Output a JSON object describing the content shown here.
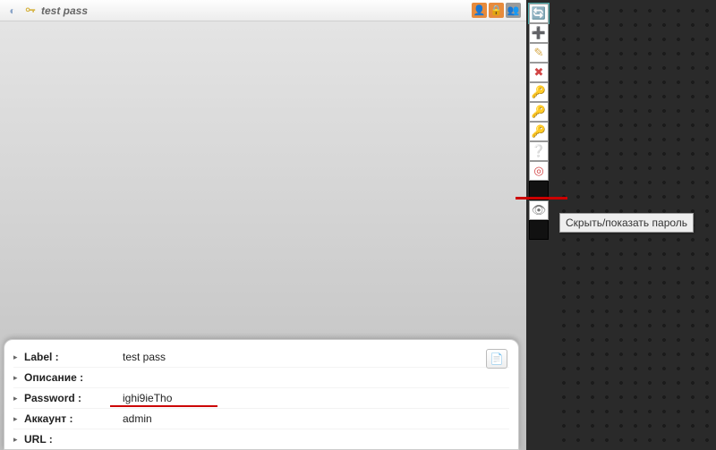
{
  "header": {
    "title": "test pass",
    "badges": [
      {
        "name": "person-badge",
        "glyph": "👤",
        "bg": "#e78b3c"
      },
      {
        "name": "lock-badge",
        "glyph": "🔒",
        "bg": "#e78b3c"
      },
      {
        "name": "people-badge",
        "glyph": "👥",
        "bg": "#9a9a9a"
      }
    ]
  },
  "details": {
    "rows": [
      {
        "label": "Label :",
        "value": "test pass"
      },
      {
        "label": "Описание :",
        "value": ""
      },
      {
        "label": "Password :",
        "value": "ighi9ieTho"
      },
      {
        "label": "Аккаунт :",
        "value": "admin"
      },
      {
        "label": "URL :",
        "value": ""
      }
    ]
  },
  "tooltip": "Скрыть/показать пароль",
  "sidebar": {
    "buttons": [
      {
        "name": "refresh",
        "glyph": "🔄",
        "color": "#2aa5d8"
      },
      {
        "name": "add",
        "glyph": "➕",
        "color": "#6fb33f"
      },
      {
        "name": "edit",
        "glyph": "✎",
        "color": "#d7a94a"
      },
      {
        "name": "delete",
        "glyph": "✖",
        "color": "#d24545"
      },
      {
        "name": "add-key",
        "glyph": "🔑",
        "color": "#cc9a2e"
      },
      {
        "name": "key",
        "glyph": "🔑",
        "color": "#d8b23c"
      },
      {
        "name": "remove-key",
        "glyph": "🔑",
        "color": "#c97c2e"
      },
      {
        "name": "help",
        "glyph": "❔",
        "color": "#4aa"
      },
      {
        "name": "target",
        "glyph": "◎",
        "color": "#d24545"
      }
    ]
  }
}
